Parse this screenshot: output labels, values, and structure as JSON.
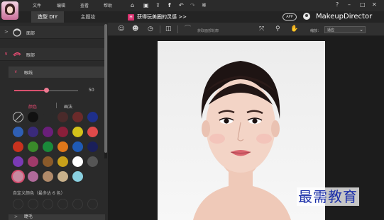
{
  "titlebar": {
    "menus": [
      "文件",
      "编辑",
      "查看",
      "帮助"
    ],
    "icons": [
      "home-icon",
      "save-icon",
      "share-icon",
      "facebook-icon",
      "undo-icon",
      "redo-icon",
      "settings-icon"
    ],
    "window_controls": [
      "?",
      "–",
      "□",
      "✕"
    ]
  },
  "tabs": [
    {
      "label": "造型 DIY",
      "active": true
    },
    {
      "label": "主题妆",
      "active": false
    }
  ],
  "promo": {
    "badge": "H",
    "text": "获得玩美圈的灵感 >>"
  },
  "app_badge": "APP",
  "brand": "MakeupDirector",
  "sidebar": {
    "sections": [
      {
        "label": "面部",
        "expanded": false
      },
      {
        "label": "眼部",
        "expanded": true
      }
    ],
    "subsections": [
      {
        "label": "眼线",
        "expanded": true
      },
      {
        "label": "睫毛",
        "expanded": false
      }
    ],
    "slider": {
      "value": 50,
      "max": 100
    },
    "color_tab": "颜色",
    "paint_tab": "画法",
    "custom_label": "自定义颜色（最多达 6 色）",
    "swatches": [
      "none",
      "#111111",
      "#2a2a2a",
      "#4a2a2a",
      "#6b2a2a",
      "#1e2f8a",
      "#2f5fb4",
      "#3a2a7a",
      "#6a1f7a",
      "#8a1f3a",
      "#d4c21a",
      "#e04a4a",
      "#c8321e",
      "#3a8a2a",
      "#1a8a3a",
      "#e0781a",
      "#1f5ab4",
      "#1a1f5a",
      "#7a3ab4",
      "#a03a6a",
      "#8a5a2a",
      "#c8a01a",
      "#ffffff",
      "#555555",
      "#c88aa0",
      "#b06a9a",
      "#b08a6a",
      "#c8b08a",
      "#8ad0e0"
    ],
    "selected_swatch": 24
  },
  "toolbar": {
    "compare_label": "获取面部轮廓",
    "zoom_label": "缩放：",
    "zoom_value": "适应"
  },
  "watermark": "最需教育"
}
